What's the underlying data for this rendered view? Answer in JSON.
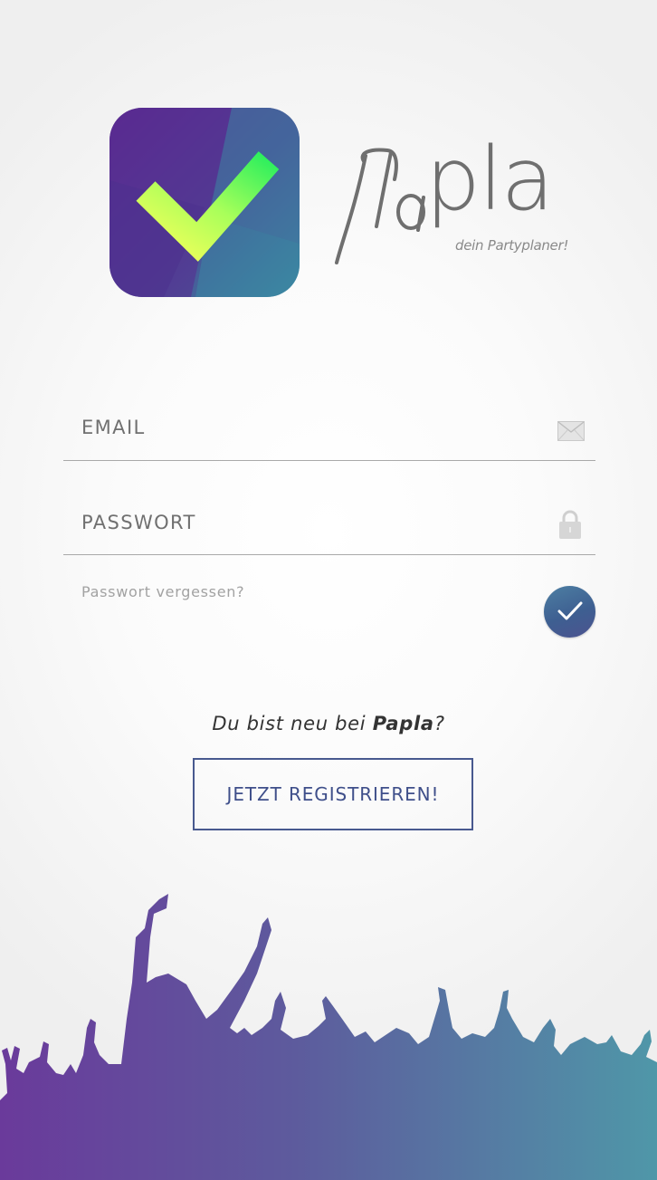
{
  "brand": {
    "name": "Papla",
    "name_rest": "pla",
    "tagline": "dein Partyplaner!"
  },
  "login": {
    "email_placeholder": "EMAIL",
    "password_placeholder": "PASSWORT",
    "forgot_password": "Passwort vergessen?"
  },
  "register": {
    "prompt_prefix": "Du bist neu bei ",
    "prompt_brand": "Papla",
    "prompt_suffix": "?",
    "button_label": "JETZT REGISTRIEREN!"
  },
  "icons": {
    "app": "checkmark-app-icon",
    "email": "envelope-icon",
    "password": "padlock-icon",
    "remember": "checkmark-icon"
  },
  "colors": {
    "accent_purple": "#5b2d8e",
    "accent_teal": "#3d8aa0",
    "check_green": "#39f25a",
    "button_border": "#48598f"
  }
}
